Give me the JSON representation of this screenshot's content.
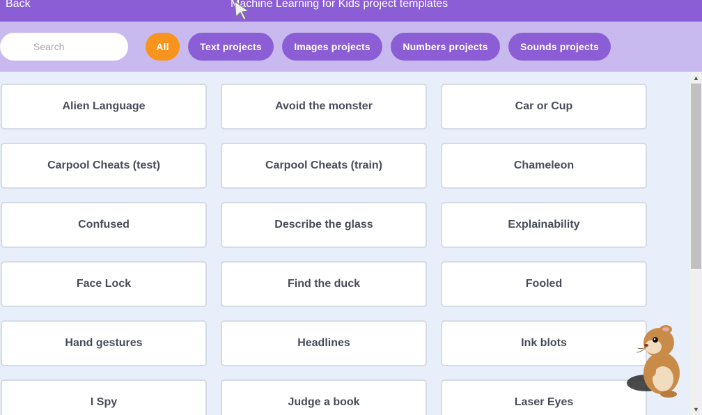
{
  "header": {
    "back_label": "Back",
    "title": "Machine Learning for Kids project templates"
  },
  "filters": {
    "search_placeholder": "Search",
    "buttons": [
      {
        "label": "All",
        "active": true
      },
      {
        "label": "Text projects",
        "active": false
      },
      {
        "label": "Images projects",
        "active": false
      },
      {
        "label": "Numbers projects",
        "active": false
      },
      {
        "label": "Sounds projects",
        "active": false
      }
    ]
  },
  "projects": [
    "Alien Language",
    "Avoid the monster",
    "Car or Cup",
    "Carpool Cheats (test)",
    "Carpool Cheats (train)",
    "Chameleon",
    "Confused",
    "Describe the glass",
    "Explainability",
    "Face Lock",
    "Find the duck",
    "Fooled",
    "Hand gestures",
    "Headlines",
    "Ink blots",
    "I Spy",
    "Judge a book",
    "Laser Eyes"
  ],
  "colors": {
    "header": "#8c5ed6",
    "filterbar": "#c8b9ef",
    "active_filter": "#f7941d",
    "page_background": "#e9effa"
  },
  "icons": {
    "mouse_cursor": "mouse-cursor-icon",
    "mascot": "hamster-mascot-icon"
  }
}
